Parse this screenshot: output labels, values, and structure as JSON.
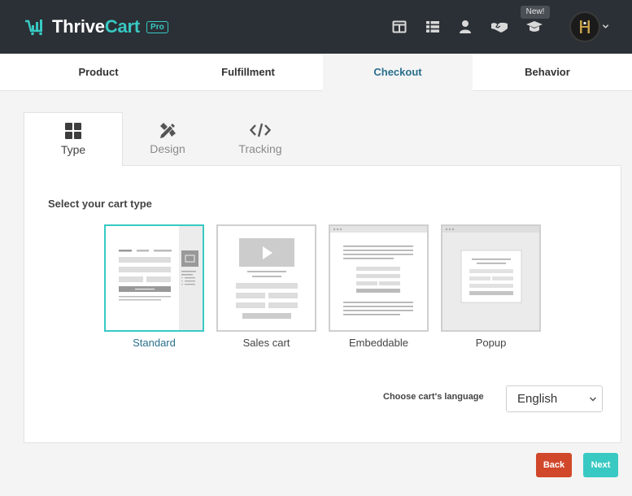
{
  "header": {
    "brand_thrive": "Thrive",
    "brand_cart": "Cart",
    "pro_badge": "Pro",
    "new_badge": "New!",
    "nav_icons": [
      "layout-icon",
      "list-icon",
      "user-icon",
      "handshake-icon",
      "graduation-cap-icon"
    ]
  },
  "main_tabs": [
    {
      "label": "Product"
    },
    {
      "label": "Fulfillment"
    },
    {
      "label": "Checkout"
    },
    {
      "label": "Behavior"
    }
  ],
  "sub_tabs": [
    {
      "label": "Type",
      "icon": "grid-icon"
    },
    {
      "label": "Design",
      "icon": "design-tools-icon"
    },
    {
      "label": "Tracking",
      "icon": "code-icon"
    }
  ],
  "cart_type": {
    "heading": "Select your cart type",
    "options": [
      {
        "label": "Standard"
      },
      {
        "label": "Sales cart"
      },
      {
        "label": "Embeddable"
      },
      {
        "label": "Popup"
      }
    ]
  },
  "language": {
    "label": "Choose cart's language",
    "value": "English"
  },
  "buttons": {
    "back": "Back",
    "next": "Next"
  },
  "colors": {
    "accent": "#38c9c3",
    "active_tab_text": "#2a6f8c",
    "back_button": "#d1472a",
    "topbar": "#2b3036"
  }
}
